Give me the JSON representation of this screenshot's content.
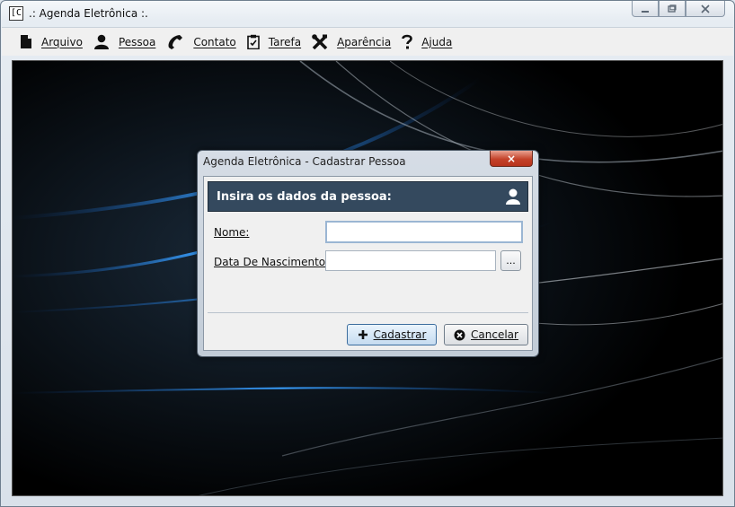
{
  "window": {
    "title": ".: Agenda Eletrônica :.",
    "app_icon_glyph": "[C"
  },
  "menu": [
    {
      "key": "arquivo",
      "label": "Arquivo",
      "icon": "file-icon"
    },
    {
      "key": "pessoa",
      "label": "Pessoa",
      "icon": "person-icon"
    },
    {
      "key": "contato",
      "label": "Contato",
      "icon": "phone-icon"
    },
    {
      "key": "tarefa",
      "label": "Tarefa",
      "icon": "clipboard-icon"
    },
    {
      "key": "aparencia",
      "label": "Aparência",
      "icon": "tools-icon"
    },
    {
      "key": "ajuda",
      "label": "Ajuda",
      "icon": "help-icon"
    }
  ],
  "dialog": {
    "title": "Agenda Eletrônica - Cadastrar Pessoa",
    "close_glyph": "×",
    "banner_text": "Insira os dados da pessoa:",
    "fields": {
      "nome": {
        "label": "Nome:",
        "value": ""
      },
      "nascimento": {
        "label": "Data De Nascimento:",
        "value": "",
        "picker_label": "..."
      }
    },
    "buttons": {
      "cadastrar": "Cadastrar",
      "cancelar": "Cancelar"
    }
  },
  "colors": {
    "banner": "#34495e",
    "desktop": "#000000",
    "accent_blue": "#2a8cff"
  }
}
